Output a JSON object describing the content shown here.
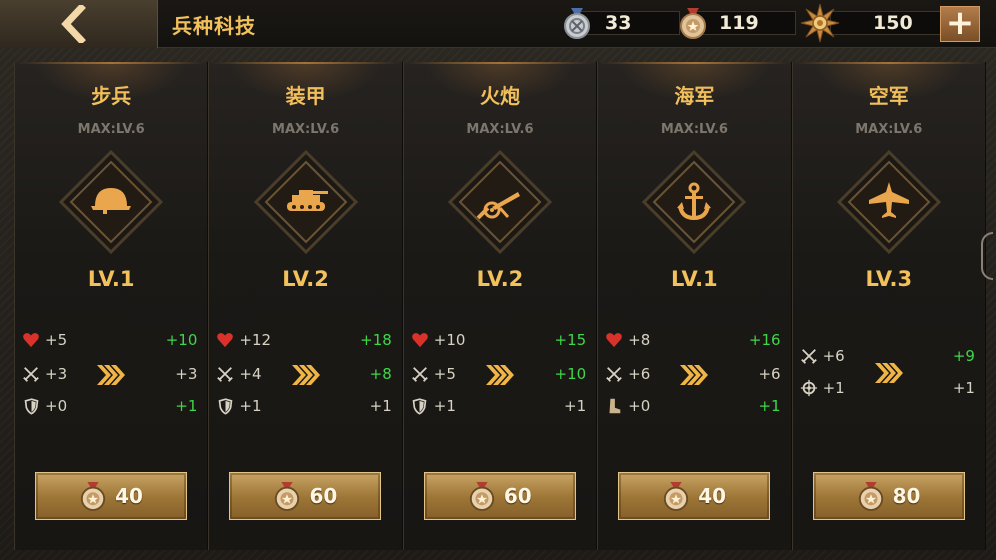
{
  "header": {
    "title": "兵种科技",
    "resources": [
      {
        "icon": "silver-medal-icon",
        "value": "33"
      },
      {
        "icon": "bronze-medal-icon",
        "value": "119"
      },
      {
        "icon": "gold-star-badge-icon",
        "value": "150"
      }
    ],
    "plus_label": "+"
  },
  "cards": [
    {
      "name": "步兵",
      "max": "MAX:LV.6",
      "level": "LV.1",
      "emblem": "helmet-icon",
      "stats": [
        {
          "icon": "heart-icon",
          "cur": "+5",
          "next": "+10",
          "next_green": true
        },
        {
          "icon": "crossed-swords-icon",
          "cur": "+3",
          "next": "+3",
          "next_green": false
        },
        {
          "icon": "shield-icon",
          "cur": "+0",
          "next": "+1",
          "next_green": true
        }
      ],
      "cost": "40"
    },
    {
      "name": "装甲",
      "max": "MAX:LV.6",
      "level": "LV.2",
      "emblem": "tank-icon",
      "stats": [
        {
          "icon": "heart-icon",
          "cur": "+12",
          "next": "+18",
          "next_green": true
        },
        {
          "icon": "crossed-swords-icon",
          "cur": "+4",
          "next": "+8",
          "next_green": true
        },
        {
          "icon": "shield-icon",
          "cur": "+1",
          "next": "+1",
          "next_green": false
        }
      ],
      "cost": "60"
    },
    {
      "name": "火炮",
      "max": "MAX:LV.6",
      "level": "LV.2",
      "emblem": "artillery-icon",
      "stats": [
        {
          "icon": "heart-icon",
          "cur": "+10",
          "next": "+15",
          "next_green": true
        },
        {
          "icon": "crossed-swords-icon",
          "cur": "+5",
          "next": "+10",
          "next_green": true
        },
        {
          "icon": "shield-icon",
          "cur": "+1",
          "next": "+1",
          "next_green": false
        }
      ],
      "cost": "60"
    },
    {
      "name": "海军",
      "max": "MAX:LV.6",
      "level": "LV.1",
      "emblem": "anchor-icon",
      "stats": [
        {
          "icon": "heart-icon",
          "cur": "+8",
          "next": "+16",
          "next_green": true
        },
        {
          "icon": "crossed-swords-icon",
          "cur": "+6",
          "next": "+6",
          "next_green": false
        },
        {
          "icon": "boot-icon",
          "cur": "+0",
          "next": "+1",
          "next_green": true
        }
      ],
      "cost": "40"
    },
    {
      "name": "空军",
      "max": "MAX:LV.6",
      "level": "LV.3",
      "emblem": "airplane-icon",
      "stats": [
        {
          "icon": "crossed-swords-icon",
          "cur": "+6",
          "next": "+9",
          "next_green": true
        },
        {
          "icon": "crosshair-icon",
          "cur": "+1",
          "next": "+1",
          "next_green": false
        }
      ],
      "cost": "80"
    }
  ],
  "colors": {
    "accent": "#f3c15c",
    "green": "#3fd64a",
    "button": "#9b7436"
  }
}
